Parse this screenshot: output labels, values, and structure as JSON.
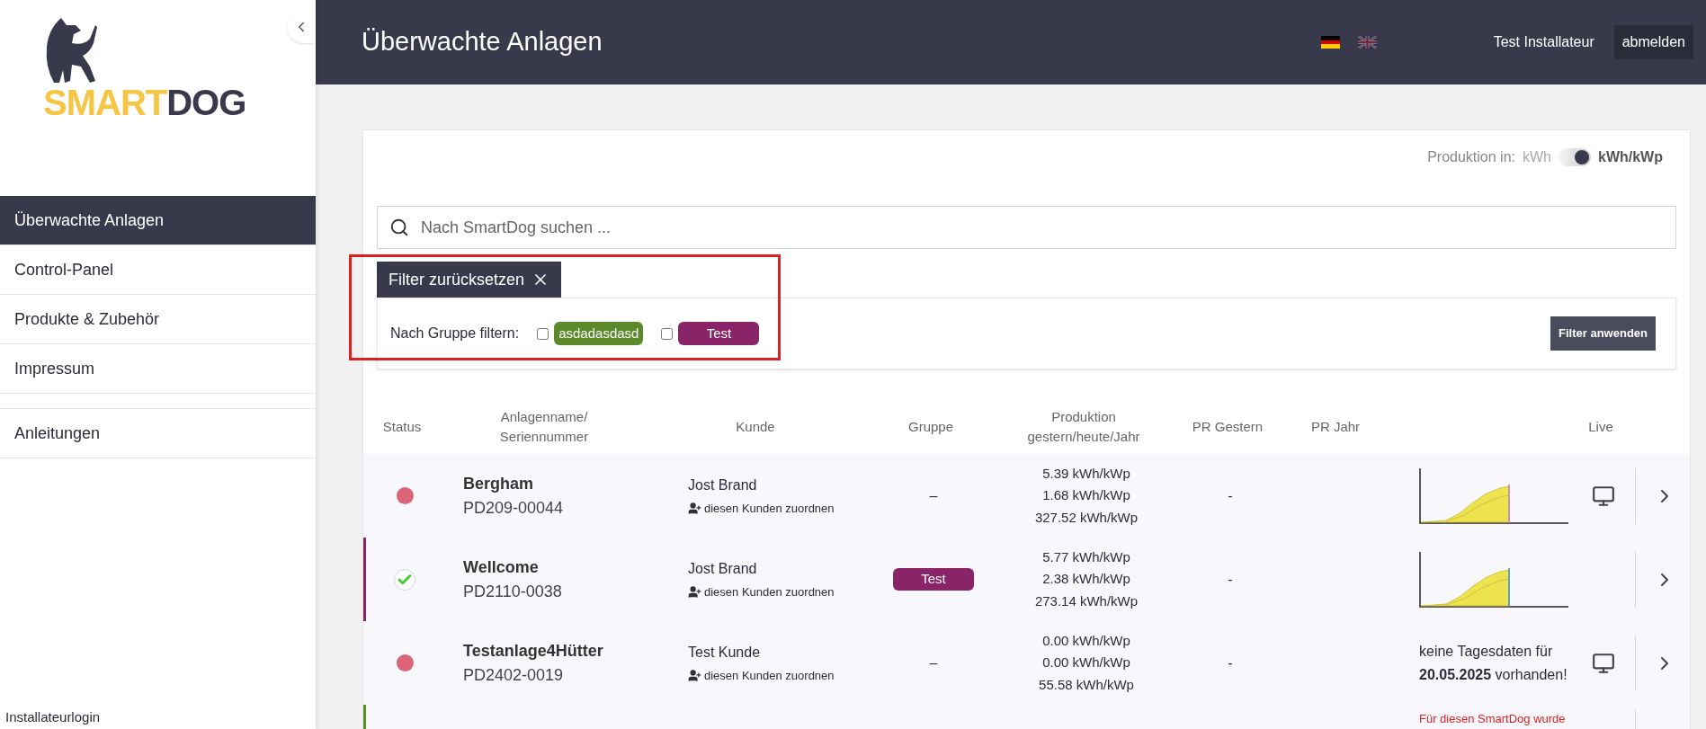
{
  "logo": {
    "part_1": "SMART",
    "part_2": "DOG"
  },
  "sidebar": {
    "items": [
      {
        "label": "Überwachte Anlagen",
        "selected": true
      },
      {
        "label": "Control-Panel",
        "selected": false
      },
      {
        "label": "Produkte & Zubehör",
        "selected": false
      },
      {
        "label": "Impressum",
        "selected": false
      }
    ],
    "extra_items": [
      {
        "label": "Anleitungen",
        "selected": false
      }
    ],
    "footer_link": "Installateurlogin"
  },
  "header": {
    "title": "Überwachte Anlagen",
    "languages": [
      {
        "kind": "de",
        "selected": true
      },
      {
        "kind": "uk",
        "selected": false
      }
    ],
    "user": "Test Installateur",
    "logout": "abmelden"
  },
  "unit_toggle": {
    "label": "Produktion in:",
    "option_1": "kWh",
    "option_2": "kWh/kWp",
    "on": true
  },
  "search": {
    "placeholder": "Nach SmartDog suchen ..."
  },
  "filter": {
    "reset": "Filter zurücksetzen",
    "label": "Nach Gruppe filtern:",
    "groups": [
      {
        "name": "asdadasdasd",
        "color": "#5b8a2b",
        "checked": false
      },
      {
        "name": "Test",
        "color": "#8a2468",
        "checked": false
      }
    ],
    "apply": "Filter anwenden"
  },
  "table": {
    "columns": [
      "Status",
      "Anlagenname/ Seriennummer",
      "Kunde",
      "Gruppe",
      "Produktion gestern/heute/Jahr",
      "PR Gestern",
      "PR Jahr",
      "Live"
    ],
    "rows": [
      {
        "kind": "error",
        "name": "Bergham",
        "serial": "PD209-00044",
        "customer": "Jost Brand",
        "assign": "diesen Kunden zuordnen",
        "group": "–",
        "production": [
          "5.39 kWh/kWp",
          "1.68 kWh/kWp",
          "327.52 kWh/kWp"
        ],
        "pr_yesterday": "-",
        "chart": true,
        "live": true
      },
      {
        "kind": "ok",
        "color": "#8a2468",
        "name": "Wellcome",
        "serial": "PD2110-0038",
        "customer": "Jost Brand",
        "assign": "diesen Kunden zuordnen",
        "group_tag": {
          "name": "Test",
          "color": "#8a2468"
        },
        "production": [
          "5.77 kWh/kWp",
          "2.38 kWh/kWp",
          "273.14 kWh/kWp"
        ],
        "pr_yesterday": "-",
        "chart": true,
        "live": false
      },
      {
        "kind": "error",
        "name": "Testanlage4Hütter",
        "serial": "PD2402-0019",
        "customer": "Test Kunde",
        "assign": "diesen Kunden zuordnen",
        "group": "–",
        "production": [
          "0.00 kWh/kWp",
          "0.00 kWh/kWp",
          "55.58 kWh/kWp"
        ],
        "pr_yesterday": "-",
        "chart": false,
        "note": "keine Tagesdaten für **20.05.2025** vorhanden!",
        "live": true
      },
      {
        "color": "#5b8a2b",
        "chart": false,
        "warning": "Für diesen SmartDog wurde",
        "live": false
      }
    ]
  }
}
